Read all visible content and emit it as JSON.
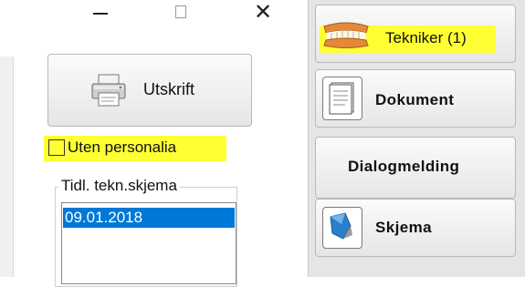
{
  "window": {
    "minimize": "minimize",
    "maximize": "maximize",
    "close_glyph": "✕"
  },
  "left": {
    "print_button_label": "Utskrift",
    "print_icon": "printer-icon",
    "checkbox": {
      "label": "Uten personalia",
      "checked": false
    },
    "group_title": "Tidl. tekn.skjema",
    "list_items": [
      "09.01.2018"
    ],
    "selected_index": 0
  },
  "right": {
    "buttons": [
      {
        "label": "Tekniker (1)",
        "icon": "teeth-icon",
        "highlighted": true
      },
      {
        "label": "Dokument",
        "icon": "document-icon"
      },
      {
        "label": "Dialogmelding",
        "icon": ""
      },
      {
        "label": "Skjema",
        "icon": "form-icon"
      }
    ]
  },
  "colors": {
    "highlight": "#ffff33",
    "selection": "#0078d7",
    "panel": "#e5e5e5"
  }
}
